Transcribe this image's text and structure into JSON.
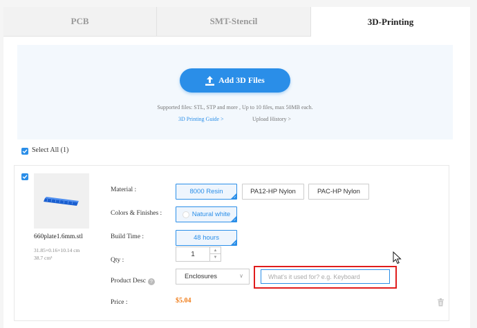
{
  "tabs": [
    {
      "label": "PCB",
      "active": false
    },
    {
      "label": "SMT-Stencil",
      "active": false
    },
    {
      "label": "3D-Printing",
      "active": true
    }
  ],
  "upload": {
    "button_label": "Add 3D Files",
    "supported_text": "Supported files: STL, STP and more , Up to 10 files, max 50MB each.",
    "guide_link": "3D Printing Guide >",
    "history_link": "Upload History >"
  },
  "select_all": {
    "label": "Select All (1)",
    "checked": true
  },
  "item": {
    "checked": true,
    "file_name": "660plate1.6mm.stl",
    "dimensions": "31.85×0.16×10.14 cm",
    "volume": "38.7 cm³",
    "material": {
      "label": "Material :",
      "options": [
        "8000 Resin",
        "PA12-HP Nylon",
        "PAC-HP Nylon"
      ],
      "selected": "8000 Resin"
    },
    "colors": {
      "label": "Colors & Finishes :",
      "selected": "Natural white"
    },
    "build_time": {
      "label": "Build Time :",
      "selected": "48 hours"
    },
    "qty": {
      "label": "Qty :",
      "value": "1"
    },
    "product_desc": {
      "label": "Product Desc",
      "category": "Enclosures",
      "placeholder": "What's it used for? e.g. Keyboard",
      "value": ""
    },
    "price": {
      "label": "Price :",
      "value": "$5.04"
    }
  },
  "colors": {
    "accent": "#2a8ee8",
    "price": "#f07d1a",
    "highlight": "#e01b1b"
  },
  "icons": [
    "upload-icon",
    "checkbox-checked-icon",
    "help-icon",
    "trash-icon",
    "mouse-cursor-icon",
    "spinner-up-icon",
    "spinner-down-icon",
    "chevron-down-icon"
  ]
}
